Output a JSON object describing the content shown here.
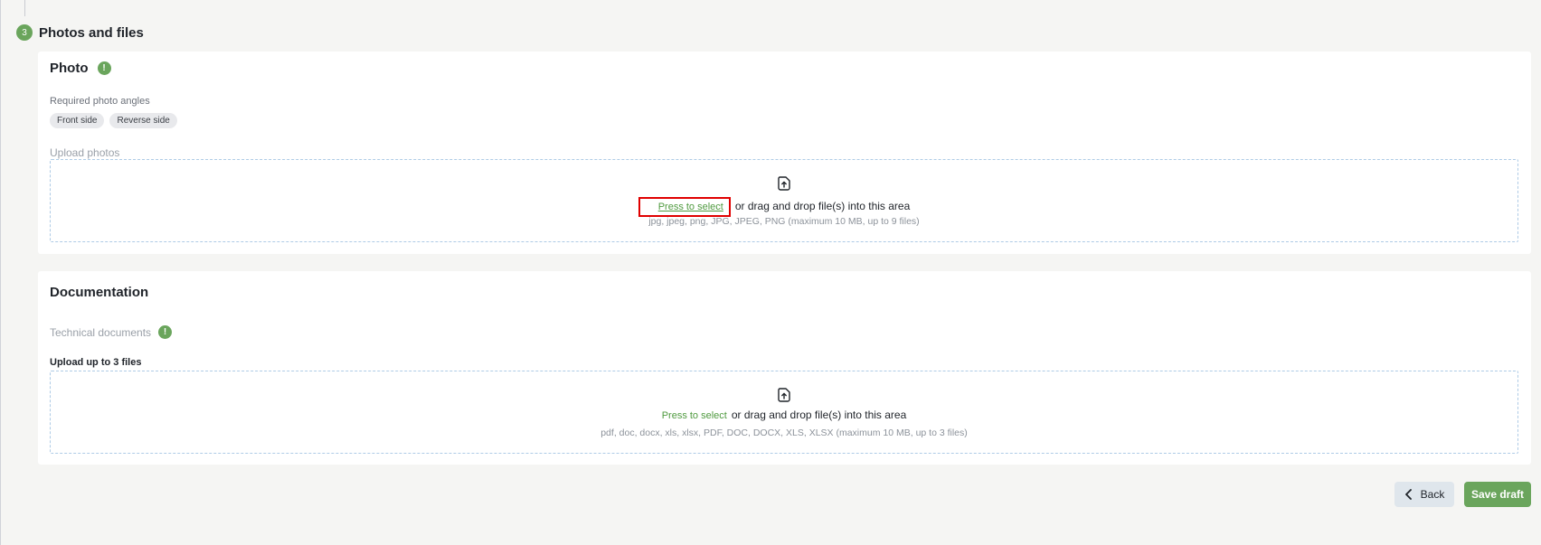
{
  "section": {
    "step_number": "3",
    "title": "Photos and files"
  },
  "photo_card": {
    "title": "Photo",
    "info_icon": "!",
    "angles_label": "Required photo angles",
    "angles": [
      "Front side",
      "Reverse side"
    ],
    "upload_label": "Upload photos",
    "dropzone": {
      "icon": "upload-file-icon",
      "select_link": "Press to select",
      "drag_text": "or drag and drop file(s) into this area",
      "hint": "jpg, jpeg, png, JPG, JPEG, PNG (maximum 10 MB, up to 9 files)"
    }
  },
  "docs_card": {
    "title": "Documentation",
    "tech_label": "Technical documents",
    "info_icon": "!",
    "upload_count": "Upload up to 3 files",
    "dropzone": {
      "icon": "upload-file-icon",
      "select_link": "Press to select",
      "drag_text": "or drag and drop file(s) into this area",
      "hint": "pdf, doc, docx, xls, xlsx, PDF, DOC, DOCX, XLS, XLSX (maximum 10 MB, up to 3 files)"
    }
  },
  "actions": {
    "back_label": "Back",
    "save_label": "Save draft"
  },
  "colors": {
    "accent": "#6aa55c",
    "link": "#4f9a3f",
    "highlight": "#e00000",
    "background": "#f5f5f3"
  }
}
